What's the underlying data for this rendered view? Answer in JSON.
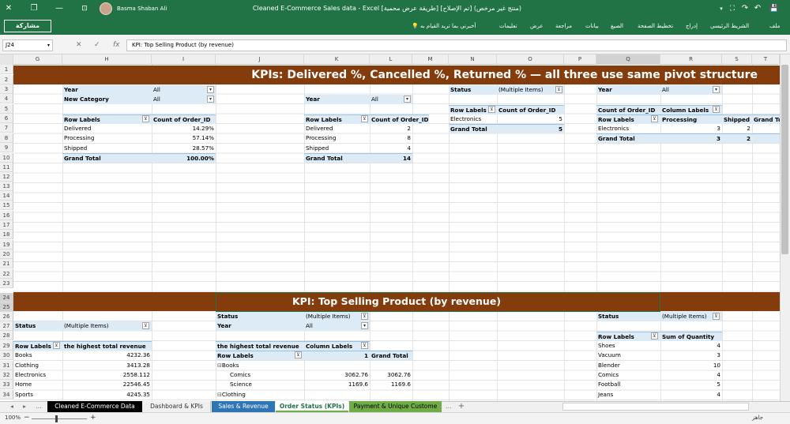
{
  "window": {
    "title": "Cleaned E-Commerce Sales data  -  Excel  [طريقة عرض محمية] [تم الإصلاح] (منتج غير مرخص)",
    "user": "Basma Shaban Ali",
    "controls": {
      "close": "✕",
      "restore": "❐",
      "minimize": "—",
      "account": "⊡"
    },
    "qat": {
      "save": "💾",
      "undo": "↶",
      "redo": "↷",
      "touch": "⛶",
      "more": "▾"
    }
  },
  "ribbon": {
    "share_label": "مشاركة",
    "tabs": [
      "ملف",
      "الشريط الرئيسي",
      "إدراج",
      "تخطيط الصفحة",
      "الصيغ",
      "بيانات",
      "مراجعة",
      "عرض",
      "تعليمات"
    ],
    "tell_me": "أخبرني بما تريد القيام به"
  },
  "formula_bar": {
    "name_box": "J24",
    "cancel": "✕",
    "enter": "✓",
    "fx": "fx",
    "formula": "KPI: Top Selling Product (by revenue)"
  },
  "columns": [
    "G",
    "H",
    "I",
    "J",
    "K",
    "L",
    "M",
    "N",
    "O",
    "P",
    "Q",
    "R",
    "S",
    "T"
  ],
  "rows": [
    "1",
    "2",
    "3",
    "4",
    "5",
    "6",
    "7",
    "8",
    "9",
    "10",
    "11",
    "12",
    "13",
    "14",
    "15",
    "16",
    "17",
    "18",
    "19",
    "20",
    "21",
    "22",
    "23",
    "24",
    "25",
    "26",
    "27",
    "28",
    "29",
    "30",
    "31",
    "32",
    "33",
    "34"
  ],
  "banner1": "KPIs: Delivered %, Cancelled %, Returned % — all three use same pivot structure",
  "banner2": "KPI: Top Selling Product (by revenue)",
  "pivot1": {
    "f1_label": "Year",
    "f1_value": "All",
    "f2_label": "New Category",
    "f2_value": "All",
    "row_labels": "Row Labels",
    "value_header": "Count of Order_ID",
    "rows": [
      {
        "label": "Delivered",
        "value": "14.29%"
      },
      {
        "label": "Processing",
        "value": "57.14%"
      },
      {
        "label": "Shipped",
        "value": "28.57%"
      }
    ],
    "total_label": "Grand Total",
    "total_value": "100.00%"
  },
  "pivot2": {
    "f_label": "Year",
    "f_value": "All",
    "row_labels": "Row Labels",
    "value_header": "Count of Order_ID",
    "rows": [
      {
        "label": "Delivered",
        "value": "2"
      },
      {
        "label": "Processing",
        "value": "8"
      },
      {
        "label": "Shipped",
        "value": "4"
      }
    ],
    "total_label": "Grand Total",
    "total_value": "14"
  },
  "pivot3": {
    "f_label": "Status",
    "f_value": "(Multiple Items)",
    "row_labels": "Row Labels",
    "value_header": "Count of Order_ID",
    "row_label": "Electronics",
    "row_value": "5",
    "total_label": "Grand Total",
    "total_value": "5"
  },
  "pivot4": {
    "f_label": "Year",
    "f_value": "All",
    "count_header": "Count of Order_ID",
    "col_labels": "Column Labels",
    "row_labels": "Row Labels",
    "col1": "Processing",
    "col2": "Shipped",
    "col3": "Grand To",
    "row_label": "Electronics",
    "v1": "3",
    "v2": "2",
    "total_label": "Grand Total",
    "t1": "3",
    "t2": "2"
  },
  "pivot5": {
    "f_label": "Status",
    "f_value": "(Multiple Items)",
    "row_labels": "Row Labels",
    "value_header": "the highest total revenue",
    "rows": [
      {
        "label": "Books",
        "value": "4232.36"
      },
      {
        "label": "Clothing",
        "value": "3413.28"
      },
      {
        "label": "Electronics",
        "value": "2558.112"
      },
      {
        "label": "Home",
        "value": "22546.45"
      },
      {
        "label": "Sports",
        "value": "4245.35"
      }
    ]
  },
  "pivot6": {
    "f1_label": "Status",
    "f1_value": "(Multiple Items)",
    "f2_label": "Year",
    "f2_value": "All",
    "value_header": "the highest total revenue",
    "col_labels": "Column Labels",
    "row_labels": "Row Labels",
    "col1": "1",
    "grand_total": "Grand Total",
    "g1": "Books",
    "i1": "Comics",
    "i1v": "3062.76",
    "i1t": "3062.76",
    "i2": "Science",
    "i2v": "1169.6",
    "i2t": "1169.6",
    "g2": "Clothing"
  },
  "pivot7": {
    "f_label": "Status",
    "f_value": "(Multiple Items)",
    "row_labels": "Row Labels",
    "value_header": "Sum of Quantity",
    "rows": [
      {
        "label": "Shoes",
        "value": "4"
      },
      {
        "label": "Vacuum",
        "value": "3"
      },
      {
        "label": "Blender",
        "value": "10"
      },
      {
        "label": "Comics",
        "value": "4"
      },
      {
        "label": "Football",
        "value": "5"
      },
      {
        "label": "Jeans",
        "value": "4"
      }
    ]
  },
  "sheet_tabs": {
    "nav_prev": "◂",
    "nav_next": "▸",
    "ellipsis": "...",
    "tabs": [
      "Cleaned E-Commerce Data",
      "Dashboard & KPIs",
      "Sales & Revenue",
      "Order Status (KPIs)",
      "Payment & Unique Custome"
    ],
    "more": "...",
    "add": "+"
  },
  "status_bar": {
    "zoom": "100%",
    "minus": "−",
    "plus": "+",
    "ready": "جاهز"
  },
  "colors": {
    "excel_green": "#217346",
    "banner": "#843c0c",
    "pivot_header": "#ddebf7",
    "tab_black": "#000000",
    "tab_blue": "#2e75b6",
    "tab_green": "#70ad47"
  }
}
